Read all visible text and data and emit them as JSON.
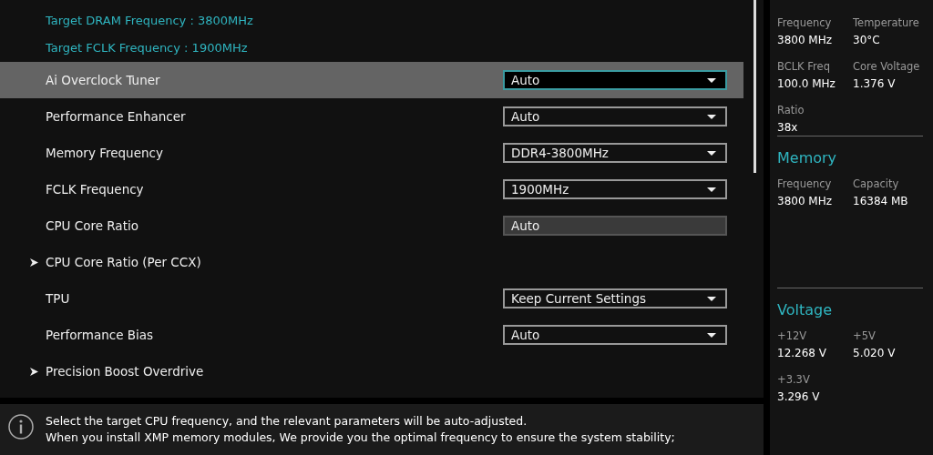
{
  "targets": [
    "Target DRAM Frequency : 3800MHz",
    "Target FCLK Frequency : 1900MHz"
  ],
  "settings": [
    {
      "kind": "dropdown",
      "label": "Ai Overclock Tuner",
      "value": "Auto",
      "selected": true
    },
    {
      "kind": "dropdown",
      "label": "Performance Enhancer",
      "value": "Auto",
      "selected": false
    },
    {
      "kind": "dropdown",
      "label": "Memory Frequency",
      "value": "DDR4-3800MHz",
      "selected": false
    },
    {
      "kind": "dropdown",
      "label": "FCLK Frequency",
      "value": "1900MHz",
      "selected": false
    },
    {
      "kind": "readonly",
      "label": "CPU Core Ratio",
      "value": "Auto",
      "selected": false
    },
    {
      "kind": "submenu",
      "label": "CPU Core Ratio (Per CCX)",
      "selected": false
    },
    {
      "kind": "dropdown",
      "label": "TPU",
      "value": "Keep Current Settings",
      "selected": false
    },
    {
      "kind": "dropdown",
      "label": "Performance Bias",
      "value": "Auto",
      "selected": false
    },
    {
      "kind": "submenu",
      "label": "Precision Boost Overdrive",
      "selected": false
    }
  ],
  "help": [
    "Select the target CPU frequency, and the relevant parameters will be auto-adjusted.",
    "When you install XMP memory modules, We provide you the optimal frequency to ensure the system stability;"
  ],
  "monitor": [
    {
      "items": [
        {
          "label": "Frequency",
          "value": "3800 MHz"
        },
        {
          "label": "Temperature",
          "value": "30°C"
        },
        {
          "label": "BCLK Freq",
          "value": "100.0 MHz"
        },
        {
          "label": "Core Voltage",
          "value": "1.376 V"
        },
        {
          "label": "Ratio",
          "value": "38x"
        }
      ]
    },
    {
      "title": "Memory",
      "items": [
        {
          "label": "Frequency",
          "value": "3800 MHz"
        },
        {
          "label": "Capacity",
          "value": "16384 MB"
        }
      ]
    },
    {
      "title": "Voltage",
      "items": [
        {
          "label": "+12V",
          "value": "12.268 V"
        },
        {
          "label": "+5V",
          "value": "5.020 V"
        },
        {
          "label": "+3.3V",
          "value": "3.296 V"
        }
      ]
    }
  ]
}
